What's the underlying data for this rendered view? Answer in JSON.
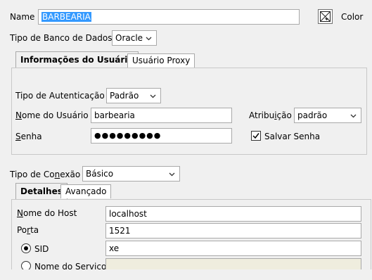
{
  "name": {
    "label": "Name",
    "value": "BARBEARIA",
    "color_label": "Color"
  },
  "db_type": {
    "label": "Tipo de Banco de Dados",
    "value": "Oracle"
  },
  "user_tabs": [
    {
      "label": "Informações do Usuário",
      "active": true
    },
    {
      "label": "Usuário Proxy",
      "active": false
    }
  ],
  "auth": {
    "label": "Tipo de Autenticação",
    "value": "Padrão"
  },
  "username": {
    "label_mn": "N",
    "label_rest": "ome do Usuário",
    "value": "barbearia"
  },
  "role": {
    "label_pre": "Atribu",
    "label_mn": "i",
    "label_post": "ção",
    "value": "padrão"
  },
  "password": {
    "label_mn": "S",
    "label_rest": "enha",
    "value": "●●●●●●●●●"
  },
  "save_password": {
    "label": "Salvar Senha",
    "checked": true
  },
  "connection_type": {
    "label_pre": "Tipo de Co",
    "label_mn": "n",
    "label_post": "exão",
    "value": "Básico"
  },
  "conn_tabs": [
    {
      "label": "Detalhes",
      "active": true
    },
    {
      "label": "Avançado",
      "active": false
    }
  ],
  "host": {
    "label_mn": "N",
    "label_rest": "ome do Host",
    "value": "localhost"
  },
  "port": {
    "label_pre": "Po",
    "label_mn": "r",
    "label_post": "ta",
    "value": "1521"
  },
  "sid": {
    "label": "SID",
    "value": "xe",
    "selected": true
  },
  "service": {
    "label": "Nome do Serviço",
    "value": "",
    "selected": false
  },
  "colors": {
    "selection": "#3399ff",
    "border": "#a9a9a9",
    "background": "#f0f0f0",
    "disabled_field": "#efedde"
  }
}
